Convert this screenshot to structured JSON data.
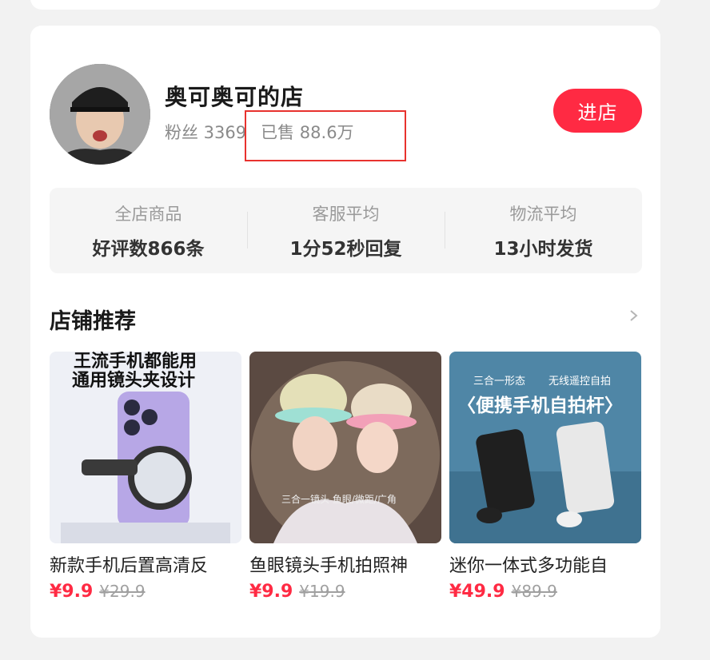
{
  "store": {
    "name": "奥可奥可的店",
    "fans": "粉丝 3369",
    "sold": "已售 88.6万",
    "enter_label": "进店"
  },
  "metrics": [
    {
      "label": "全店商品",
      "value": "好评数866条"
    },
    {
      "label": "客服平均",
      "value": "1分52秒回复"
    },
    {
      "label": "物流平均",
      "value": "13小时发货"
    }
  ],
  "section": {
    "title": "店铺推荐",
    "more_icon": "chevron-right-icon"
  },
  "products": [
    {
      "title": "新款手机后置高清反",
      "price": "¥9.9",
      "original_price": "¥29.9",
      "image_text": [
        "王流手机都能用",
        "通用镜头夹设计"
      ]
    },
    {
      "title": "鱼眼镜头手机拍照神",
      "price": "¥9.9",
      "original_price": "¥19.9",
      "image_text": [
        "三合一镜头 鱼眼/微距/广角"
      ]
    },
    {
      "title": "迷你一体式多功能自",
      "price": "¥49.9",
      "original_price": "¥89.9",
      "image_text": [
        "三合一形态",
        "无线遥控自拍",
        "〈便携手机自拍杆〉"
      ]
    }
  ],
  "colors": {
    "accent": "#ff2a43",
    "highlight_box": "#e8322e"
  }
}
